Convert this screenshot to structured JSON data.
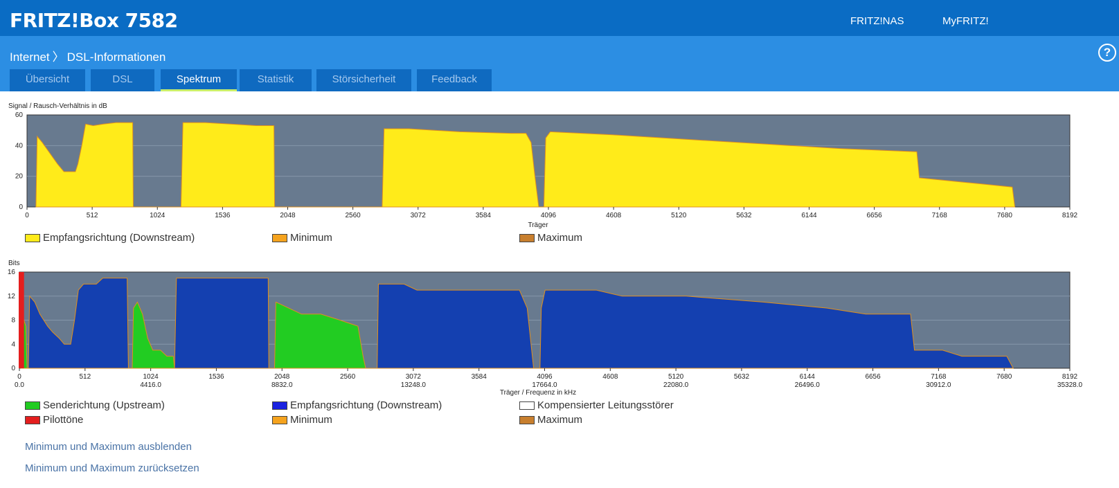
{
  "header": {
    "title": "FRITZ!Box 7582",
    "links": [
      "FRITZ!NAS",
      "MyFRITZ!"
    ]
  },
  "breadcrumb": {
    "parent": "Internet",
    "separator": "〉",
    "current": "DSL-Informationen"
  },
  "help_symbol": "?",
  "tabs": [
    {
      "label": "Übersicht",
      "active": false
    },
    {
      "label": "DSL",
      "active": false
    },
    {
      "label": "Spektrum",
      "active": true
    },
    {
      "label": "Statistik",
      "active": false
    },
    {
      "label": "Störsicherheit",
      "active": false
    },
    {
      "label": "Feedback",
      "active": false
    }
  ],
  "colors": {
    "plot_bg": "#687a8f",
    "downstream_snr": "#ffeb1a",
    "downstream_bits": "#1440b0",
    "upstream": "#22cc22",
    "pilot": "#e41e1e",
    "minimum": "#f5a31e",
    "maximum": "#c87f2e",
    "compensated": "#ffffff",
    "tab_accent": "#c9ef6a"
  },
  "chart_data": [
    {
      "type": "area",
      "title": "Signal / Rausch-Verhältnis in dB",
      "xlabel": "Träger",
      "ylabel": "Signal / Rausch-Verhältnis in dB",
      "xlim": [
        0,
        8192
      ],
      "ylim": [
        0,
        60
      ],
      "xticks": [
        0,
        512,
        1024,
        1536,
        2048,
        2560,
        3072,
        3584,
        4096,
        4608,
        5120,
        5632,
        6144,
        6656,
        7168,
        7680,
        8192
      ],
      "yticks": [
        0,
        20,
        40,
        60
      ],
      "grid": true,
      "legend_position": "bottom",
      "series": [
        {
          "name": "Empfangsrichtung (Downstream)",
          "color": "#ffeb1a",
          "points": [
            [
              70,
              0
            ],
            [
              80,
              46
            ],
            [
              120,
              42
            ],
            [
              180,
              35
            ],
            [
              240,
              28
            ],
            [
              290,
              23
            ],
            [
              330,
              23
            ],
            [
              380,
              23
            ],
            [
              400,
              28
            ],
            [
              430,
              40
            ],
            [
              460,
              54
            ],
            [
              520,
              53
            ],
            [
              600,
              54
            ],
            [
              700,
              55
            ],
            [
              830,
              55
            ],
            [
              835,
              0
            ],
            [
              1210,
              0
            ],
            [
              1225,
              55
            ],
            [
              1400,
              55
            ],
            [
              1600,
              54
            ],
            [
              1800,
              53
            ],
            [
              1900,
              53
            ],
            [
              1940,
              53
            ],
            [
              1945,
              0
            ],
            [
              2790,
              0
            ],
            [
              2805,
              51
            ],
            [
              3000,
              51
            ],
            [
              3400,
              49
            ],
            [
              3800,
              48
            ],
            [
              3920,
              48
            ],
            [
              3960,
              42
            ],
            [
              3990,
              20
            ],
            [
              4020,
              0
            ],
            [
              4060,
              0
            ],
            [
              4075,
              45
            ],
            [
              4110,
              49
            ],
            [
              4600,
              47
            ],
            [
              5200,
              44
            ],
            [
              5800,
              41
            ],
            [
              6400,
              38
            ],
            [
              6990,
              36
            ],
            [
              7010,
              19
            ],
            [
              7500,
              15
            ],
            [
              7740,
              13
            ],
            [
              7760,
              0
            ]
          ]
        },
        {
          "name": "Minimum",
          "color": "#f5a31e"
        },
        {
          "name": "Maximum",
          "color": "#c87f2e"
        }
      ]
    },
    {
      "type": "area",
      "title": "Bits",
      "xlabel": "Träger / Frequenz in kHz",
      "ylabel": "Bits",
      "xlim": [
        0,
        8192
      ],
      "ylim": [
        0,
        16
      ],
      "xticks": [
        0,
        512,
        1024,
        1536,
        2048,
        2560,
        3072,
        3584,
        4096,
        4608,
        5120,
        5632,
        6144,
        6656,
        7168,
        7680,
        8192
      ],
      "freq_ticks": [
        {
          "carrier": 0,
          "label": "0.0"
        },
        {
          "carrier": 1024,
          "label": "4416.0"
        },
        {
          "carrier": 2048,
          "label": "8832.0"
        },
        {
          "carrier": 3072,
          "label": "13248.0"
        },
        {
          "carrier": 4096,
          "label": "17664.0"
        },
        {
          "carrier": 5120,
          "label": "22080.0"
        },
        {
          "carrier": 6144,
          "label": "26496.0"
        },
        {
          "carrier": 7168,
          "label": "30912.0"
        },
        {
          "carrier": 8192,
          "label": "35328.0"
        }
      ],
      "yticks": [
        0,
        4,
        8,
        12,
        16
      ],
      "grid": true,
      "legend_position": "bottom",
      "series": [
        {
          "name": "Sendericht​ung (Upstream)",
          "color": "#22cc22",
          "points": [
            [
              10,
              0
            ],
            [
              20,
              9
            ],
            [
              50,
              7
            ],
            [
              60,
              0
            ],
            [
              880,
              0
            ],
            [
              890,
              10
            ],
            [
              920,
              11
            ],
            [
              960,
              9
            ],
            [
              1000,
              5
            ],
            [
              1040,
              3
            ],
            [
              1100,
              3
            ],
            [
              1150,
              2
            ],
            [
              1200,
              2
            ],
            [
              1210,
              0
            ],
            [
              1990,
              0
            ],
            [
              2000,
              11
            ],
            [
              2100,
              10
            ],
            [
              2200,
              9
            ],
            [
              2350,
              9
            ],
            [
              2500,
              8
            ],
            [
              2640,
              7
            ],
            [
              2680,
              2
            ],
            [
              2700,
              0
            ]
          ]
        },
        {
          "name": "Empfangsrichtung (Downstream)",
          "color": "#1440b0",
          "points": [
            [
              70,
              0
            ],
            [
              80,
              12
            ],
            [
              120,
              11
            ],
            [
              160,
              9
            ],
            [
              220,
              7
            ],
            [
              260,
              6
            ],
            [
              310,
              5
            ],
            [
              350,
              4
            ],
            [
              400,
              4
            ],
            [
              430,
              8
            ],
            [
              460,
              13
            ],
            [
              500,
              14
            ],
            [
              600,
              14
            ],
            [
              650,
              15
            ],
            [
              840,
              15
            ],
            [
              850,
              0
            ],
            [
              1210,
              0
            ],
            [
              1225,
              15
            ],
            [
              1500,
              15
            ],
            [
              1700,
              15
            ],
            [
              1900,
              15
            ],
            [
              1940,
              15
            ],
            [
              1945,
              0
            ],
            [
              2790,
              0
            ],
            [
              2800,
              14
            ],
            [
              3000,
              14
            ],
            [
              3100,
              13
            ],
            [
              3400,
              13
            ],
            [
              3900,
              13
            ],
            [
              3960,
              10
            ],
            [
              3990,
              4
            ],
            [
              4010,
              0
            ],
            [
              4060,
              0
            ],
            [
              4070,
              10
            ],
            [
              4100,
              13
            ],
            [
              4500,
              13
            ],
            [
              4700,
              12
            ],
            [
              5200,
              12
            ],
            [
              5800,
              11
            ],
            [
              6300,
              10
            ],
            [
              6600,
              9
            ],
            [
              6950,
              9
            ],
            [
              6980,
              3
            ],
            [
              7200,
              3
            ],
            [
              7350,
              2
            ],
            [
              7700,
              2
            ],
            [
              7750,
              0
            ]
          ]
        },
        {
          "name": "Kompensierter Leitungsstörer",
          "color": "#ffffff"
        },
        {
          "name": "Pilottöne",
          "color": "#e41e1e",
          "carriers": [
            0,
            20
          ]
        },
        {
          "name": "Minimum",
          "color": "#f5a31e"
        },
        {
          "name": "Maximum",
          "color": "#c87f2e"
        }
      ]
    }
  ],
  "legend1": [
    "Empfangsrichtung (Downstream)",
    "Minimum",
    "Maximum"
  ],
  "legend2": [
    "Senderichtung (Upstream)",
    "Empfangsrichtung (Downstream)",
    "Kompensierter Leitungsstörer",
    "Pilottöne",
    "Minimum",
    "Maximum"
  ],
  "actions": [
    "Minimum und Maximum ausblenden",
    "Minimum und Maximum zurücksetzen"
  ]
}
